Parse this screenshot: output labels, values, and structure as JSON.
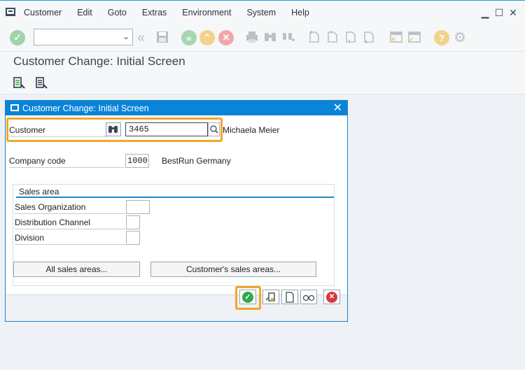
{
  "menubar": [
    "Customer",
    "Edit",
    "Goto",
    "Extras",
    "Environment",
    "System",
    "Help"
  ],
  "window_controls": {
    "minimize": "▁",
    "maximize": "☐",
    "close": "✕"
  },
  "toolbar": {
    "command_field": ""
  },
  "page_title": "Customer Change: Initial Screen",
  "dialog": {
    "title": "Customer Change: Initial Screen",
    "customer_label": "Customer",
    "customer_value": "3465",
    "customer_name": "Michaela Meier",
    "company_code_label": "Company code",
    "company_code_value": "1000",
    "company_name": "BestRun Germany",
    "sales_area_title": "Sales area",
    "sales_org_label": "Sales Organization",
    "distribution_channel_label": "Distribution Channel",
    "division_label": "Division",
    "all_sales_areas_button": "All sales areas...",
    "customers_sales_areas_button": "Customer's sales areas..."
  },
  "colors": {
    "accent": "#0a84d8",
    "highlight": "#f0a829",
    "ok_green": "#2ea84a",
    "cancel_red": "#d9363e"
  }
}
